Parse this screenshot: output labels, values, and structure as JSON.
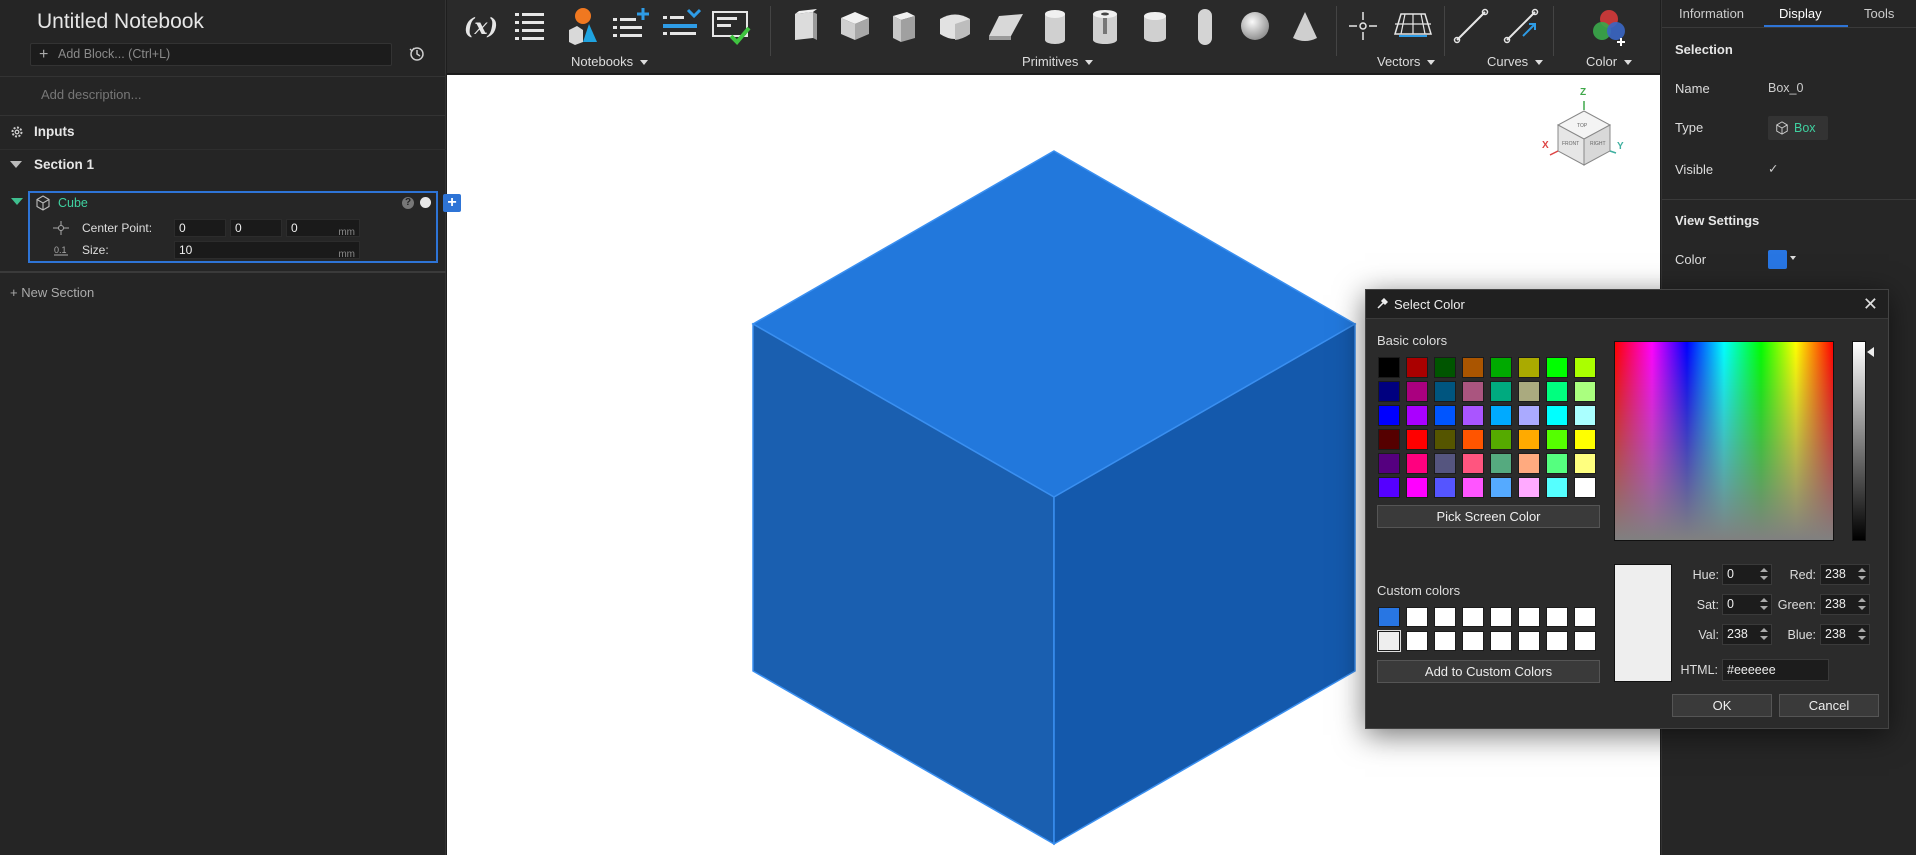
{
  "notebook": {
    "title": "Untitled Notebook",
    "add_block_placeholder": "Add Block... (Ctrl+L)",
    "description_placeholder": "Add description...",
    "inputs_label": "Inputs",
    "section_label": "Section 1",
    "block": {
      "name": "Cube",
      "help_glyph": "?",
      "params": [
        {
          "label": "Center Point:",
          "values": [
            "0",
            "0",
            "0"
          ],
          "unit": "mm"
        },
        {
          "label": "Size:",
          "values": [
            "10"
          ],
          "unit": "mm"
        }
      ]
    },
    "add_block_glyph": "+",
    "new_section_label": "New Section",
    "new_section_glyph": "+"
  },
  "toolbar": {
    "groups": [
      {
        "label": "Notebooks"
      },
      {
        "label": "Primitives"
      },
      {
        "label": "Vectors"
      },
      {
        "label": "Curves"
      },
      {
        "label": "Color"
      }
    ],
    "icons": [
      "variable-icon",
      "list-icon",
      "shapes-icon",
      "add-list-icon",
      "insert-list-icon",
      "checklist-icon",
      "box-icon",
      "cube-icon",
      "tall-box-icon",
      "rounded-cube-icon",
      "wedge-icon",
      "cylinder-icon",
      "tube-icon",
      "short-cylinder-icon",
      "capsule-icon",
      "sphere-icon",
      "cone-icon",
      "point-icon",
      "plane-icon",
      "line-icon",
      "vector-line-icon",
      "color-mix-icon"
    ],
    "variable_glyph": "(x)"
  },
  "viewcube": {
    "z": "Z",
    "x": "X",
    "y": "Y",
    "top": "TOP",
    "front": "FRONT",
    "right": "RIGHT"
  },
  "right_panel": {
    "tabs": [
      "Information",
      "Display",
      "Tools"
    ],
    "active_tab": "Display",
    "selection_heading": "Selection",
    "name_label": "Name",
    "name_value": "Box_0",
    "type_label": "Type",
    "type_value": "Box",
    "visible_label": "Visible",
    "visible_value": "✓",
    "view_settings_heading": "View Settings",
    "color_label": "Color",
    "color_value": "#2876e3"
  },
  "color_dialog": {
    "title": "Select Color",
    "close_glyph": "✕",
    "basic_colors_label": "Basic colors",
    "basic_colors": [
      "#000000",
      "#aa0000",
      "#005500",
      "#aa5500",
      "#00aa00",
      "#aaaa00",
      "#00ff00",
      "#aaff00",
      "#00007f",
      "#aa007f",
      "#00557f",
      "#aa557f",
      "#00aa7f",
      "#aaaa7f",
      "#00ff7f",
      "#aaff7f",
      "#0000ff",
      "#aa00ff",
      "#0055ff",
      "#aa55ff",
      "#00aaff",
      "#aaaaff",
      "#00ffff",
      "#aaffff",
      "#550000",
      "#ff0000",
      "#555500",
      "#ff5500",
      "#55aa00",
      "#ffaa00",
      "#55ff00",
      "#ffff00",
      "#55007f",
      "#ff007f",
      "#55557f",
      "#ff557f",
      "#55aa7f",
      "#ffaa7f",
      "#55ff7f",
      "#ffff7f",
      "#5500ff",
      "#ff00ff",
      "#5555ff",
      "#ff55ff",
      "#55aaff",
      "#ffaaff",
      "#55ffff",
      "#ffffff"
    ],
    "pick_screen_label": "Pick Screen Color",
    "custom_colors_label": "Custom colors",
    "custom_colors": [
      "#2876e3",
      "#ffffff",
      "#ffffff",
      "#ffffff",
      "#ffffff",
      "#ffffff",
      "#ffffff",
      "#ffffff",
      "#eeeeee",
      "#ffffff",
      "#ffffff",
      "#ffffff",
      "#ffffff",
      "#ffffff",
      "#ffffff",
      "#ffffff"
    ],
    "add_custom_label": "Add to Custom Colors",
    "hue_label": "Hue:",
    "hue": "0",
    "sat_label": "Sat:",
    "sat": "0",
    "val_label": "Val:",
    "val": "238",
    "red_label": "Red:",
    "red": "238",
    "green_label": "Green:",
    "green": "238",
    "blue_label": "Blue:",
    "blue": "238",
    "html_label": "HTML:",
    "html": "#eeeeee",
    "ok_label": "OK",
    "cancel_label": "Cancel"
  },
  "colors": {
    "accent": "#2e74d6",
    "cube_top": "#2278dc",
    "cube_left": "#1a5fb0",
    "cube_right": "#1459ac",
    "teal": "#3fd1a0"
  }
}
